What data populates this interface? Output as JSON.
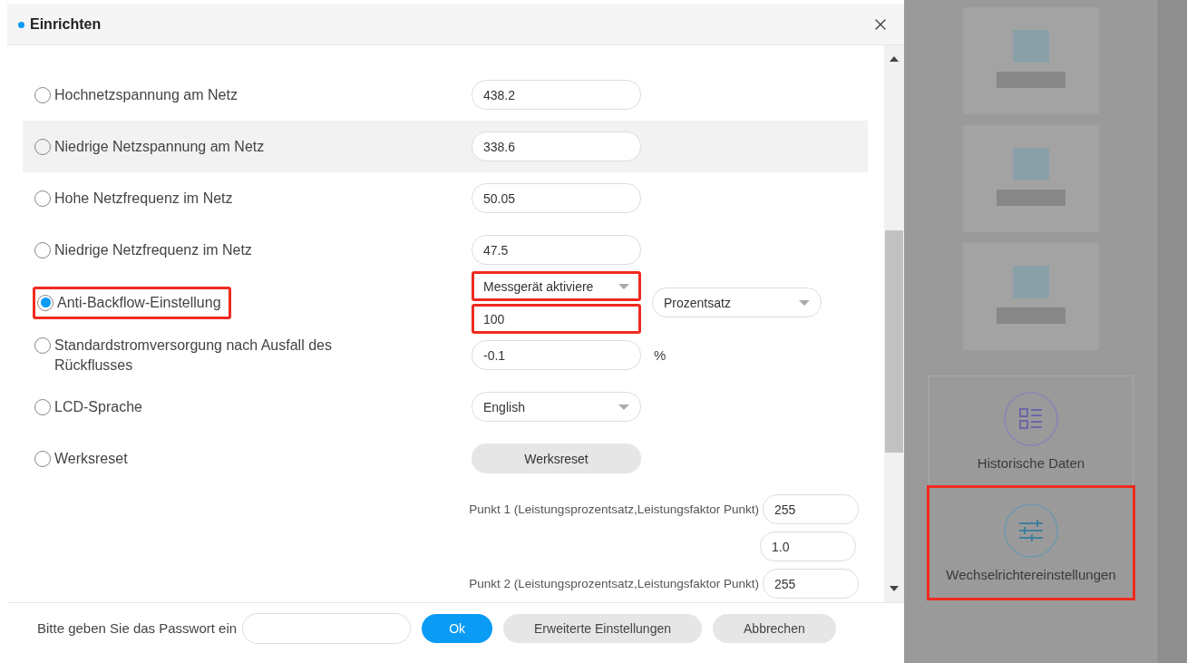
{
  "dialog": {
    "title": "Einrichten",
    "settings": [
      {
        "label": "Hochnetzspannung am Netz",
        "selected": false,
        "highlighted": false,
        "shaded": false,
        "controls": [
          {
            "kind": "input",
            "value": "438.2"
          }
        ]
      },
      {
        "label": "Niedrige Netzspannung am Netz",
        "selected": false,
        "highlighted": false,
        "shaded": true,
        "controls": [
          {
            "kind": "input",
            "value": "338.6"
          }
        ]
      },
      {
        "label": "Hohe Netzfrequenz im Netz",
        "selected": false,
        "highlighted": false,
        "shaded": false,
        "controls": [
          {
            "kind": "input",
            "value": "50.05"
          }
        ]
      },
      {
        "label": "Niedrige Netzfrequenz im Netz",
        "selected": false,
        "highlighted": false,
        "shaded": false,
        "controls": [
          {
            "kind": "input",
            "value": "47.5"
          }
        ]
      },
      {
        "label": "Anti-Backflow-Einstellung",
        "selected": true,
        "highlighted": true,
        "shaded": false,
        "controls": [
          {
            "kind": "select",
            "value": "Messgerät aktiviere",
            "highlighted": true
          },
          {
            "kind": "input",
            "value": "100",
            "highlighted": true
          }
        ],
        "extra": {
          "kind": "select",
          "value": "Prozentsatz"
        }
      },
      {
        "label": "Standardstromversorgung nach Ausfall des Rückflusses",
        "selected": false,
        "highlighted": false,
        "shaded": false,
        "controls": [
          {
            "kind": "input",
            "value": "-0.1"
          }
        ],
        "extra": {
          "kind": "unit",
          "value": "%"
        }
      },
      {
        "label": "LCD-Sprache",
        "selected": false,
        "highlighted": false,
        "shaded": false,
        "controls": [
          {
            "kind": "select",
            "value": "English"
          }
        ]
      },
      {
        "label": "Werksreset",
        "selected": false,
        "highlighted": false,
        "shaded": false,
        "controls": [
          {
            "kind": "button",
            "value": "Werksreset"
          }
        ]
      }
    ],
    "points": [
      {
        "label": "Punkt 1 (Leistungsprozentsatz,Leistungsfaktor Punkt)",
        "values": [
          "255",
          "1.0"
        ]
      },
      {
        "label": "Punkt 2 (Leistungsprozentsatz,Leistungsfaktor Punkt)",
        "values": [
          "255"
        ]
      }
    ],
    "footer": {
      "password_label": "Bitte geben Sie das Passwort ein",
      "buttons": [
        {
          "label": "Ok",
          "kind": "primary"
        },
        {
          "label": "Erweiterte Einstellungen",
          "kind": "secondary"
        },
        {
          "label": "Abbrechen",
          "kind": "secondary"
        }
      ]
    }
  },
  "background": {
    "tiles": [
      {
        "label": "Historische Daten",
        "kind": "list",
        "highlighted": false
      },
      {
        "label": "Wechselrichtereinstellungen",
        "kind": "sliders",
        "highlighted": true
      }
    ]
  }
}
